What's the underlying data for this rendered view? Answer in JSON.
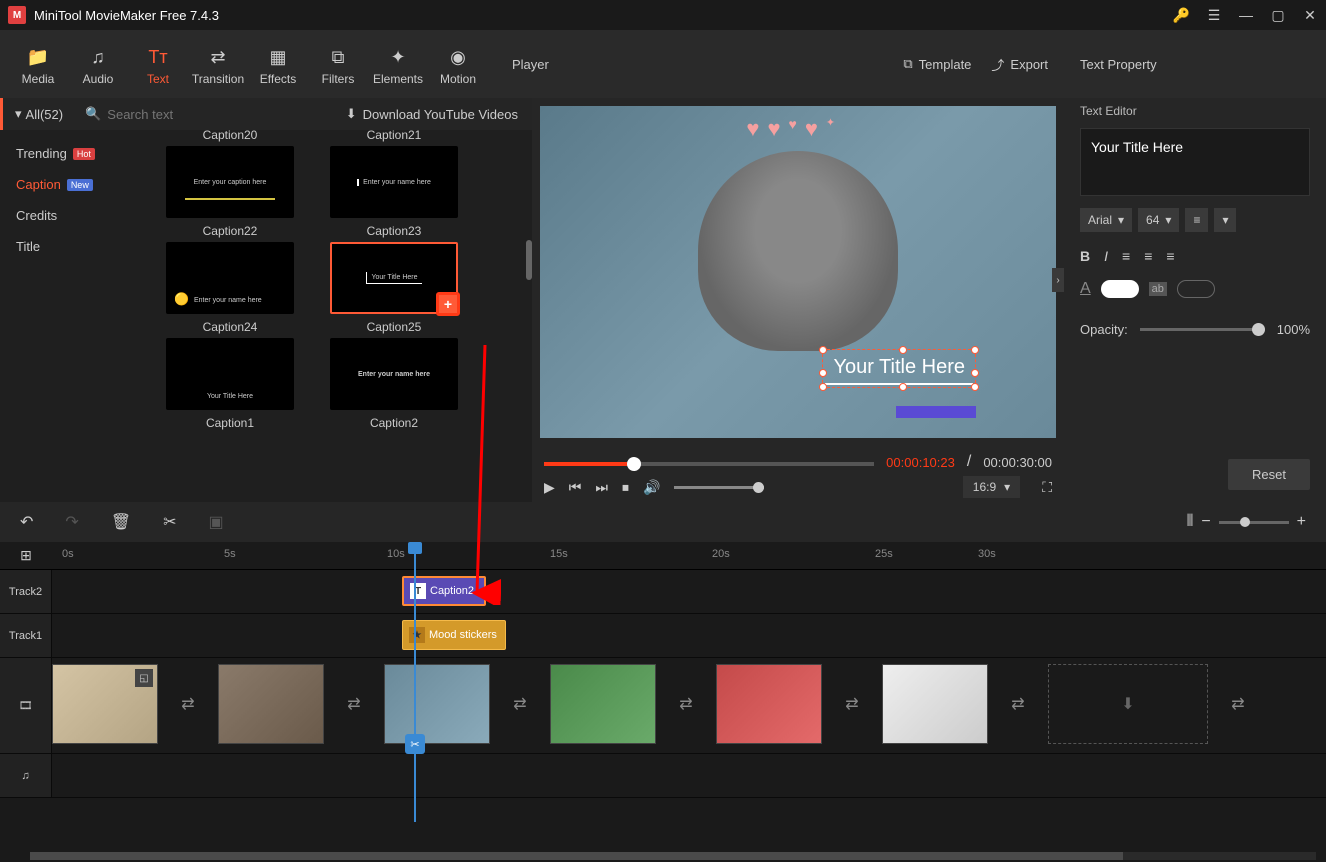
{
  "app": {
    "title": "MiniTool MovieMaker Free 7.4.3"
  },
  "tabs": [
    {
      "label": "Media"
    },
    {
      "label": "Audio"
    },
    {
      "label": "Text"
    },
    {
      "label": "Transition"
    },
    {
      "label": "Effects"
    },
    {
      "label": "Filters"
    },
    {
      "label": "Elements"
    },
    {
      "label": "Motion"
    }
  ],
  "player": {
    "title": "Player",
    "template_btn": "Template",
    "export_btn": "Export"
  },
  "textpanel": {
    "all_label": "All(52)",
    "search_placeholder": "Search text",
    "download_label": "Download YouTube Videos",
    "cats": [
      {
        "label": "Trending",
        "badge": "Hot"
      },
      {
        "label": "Caption",
        "badge": "New"
      },
      {
        "label": "Credits"
      },
      {
        "label": "Title"
      }
    ],
    "thumbs": [
      {
        "label": "Caption20"
      },
      {
        "label": "Caption21"
      },
      {
        "label": "Caption22",
        "hint": "Enter your caption here"
      },
      {
        "label": "Caption23",
        "hint": "Enter your name here"
      },
      {
        "label": "Caption24",
        "hint": "Enter your name here"
      },
      {
        "label": "Caption25",
        "hint": "Your Title Here"
      },
      {
        "label": "Caption1",
        "hint": "Your Title Here"
      },
      {
        "label": "Caption2",
        "hint": "Enter your name here"
      }
    ]
  },
  "preview": {
    "overlay_text": "Your Title Here"
  },
  "playback": {
    "current": "00:00:10:23",
    "total": "00:00:30:00",
    "ratio": "16:9"
  },
  "property": {
    "title": "Text Property",
    "editor_label": "Text Editor",
    "text_value": "Your Title Here",
    "font": "Arial",
    "size": "64",
    "opacity_label": "Opacity:",
    "opacity_value": "100%",
    "reset": "Reset"
  },
  "timeline": {
    "marks": [
      "0s",
      "5s",
      "10s",
      "15s",
      "20s",
      "25s",
      "30s"
    ],
    "track2": "Track2",
    "track1": "Track1",
    "caption_clip": "Caption2",
    "mood_clip": "Mood stickers"
  }
}
